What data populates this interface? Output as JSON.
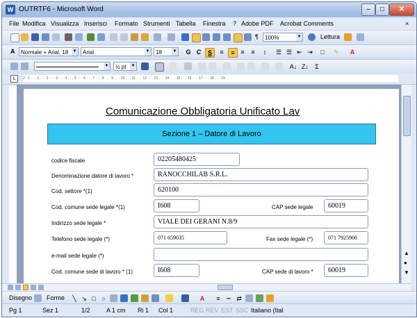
{
  "window": {
    "title": "OUTRTF6 - Microsoft Word"
  },
  "menu": [
    "File",
    "Modifica",
    "Visualizza",
    "Inserisci",
    "Formato",
    "Strumenti",
    "Tabella",
    "Finestra",
    "?",
    "Adobe PDF",
    "Acrobat Comments"
  ],
  "toolbar": {
    "zoom": "100%",
    "reading": "Lettura"
  },
  "format_bar": {
    "style": "Normale + Arial, 18",
    "font": "Arial",
    "size": "18",
    "bold": "G",
    "italic": "C",
    "underline": "S"
  },
  "ruler": {
    "scale": "2 · 1 · · · 1 · · · 2 · · · 3 · · · 4 · · · 5 · · · 6 · · · 7 · · · 8 · · · 9 · · · 10 · · · 11 · · · 12 · · · 13 · · · 14 · · · 15 · · · 16 · · · 17 · · · 18 · · · 19"
  },
  "document": {
    "title": "Comunicazione Obbligatoria Unificato Lav",
    "section": "Sezione 1 – Datore di Lavoro",
    "fields": {
      "codice_fiscale": {
        "label": "codice fiscale",
        "value": "02205480425"
      },
      "denominazione": {
        "label": "Denominazione datore di lavoro *",
        "value": "RANOCCHILAB S.R.L."
      },
      "settore": {
        "label": "Cod. settore *(1)",
        "value": "620100"
      },
      "comune_legale": {
        "label": "Cod. comune sede legale *(1)",
        "value": "I608"
      },
      "cap_legale": {
        "label": "CAP sede legale",
        "value": "60019"
      },
      "indirizzo_legale": {
        "label": "Indirizzo sede legale *",
        "value": "VIALE DEI GERANI N.8/9"
      },
      "telefono_legale": {
        "label": "Telefono sede legale (*)",
        "value": "071 659035"
      },
      "fax_legale": {
        "label": "Fax sede legale (*)",
        "value": "071 7925966"
      },
      "email_legale": {
        "label": "e-mail sede legale (*)",
        "value": ""
      },
      "comune_lavoro": {
        "label": "Cod. comune sede di lavoro * (1)",
        "value": "I608"
      },
      "cap_lavoro": {
        "label": "CAP sede di lavoro *",
        "value": "60019"
      }
    }
  },
  "drawbar": {
    "draw": "Disegno",
    "shapes": "Forme"
  },
  "status": {
    "page": "Pg 1",
    "section": "Sez 1",
    "pages": "1/2",
    "at": "A 1 cm",
    "line": "Ri 1",
    "col": "Col 1",
    "rec": "REG",
    "trk": "REV",
    "ext": "EST",
    "ovr": "SSC",
    "lang": "Italiano (Ital"
  }
}
